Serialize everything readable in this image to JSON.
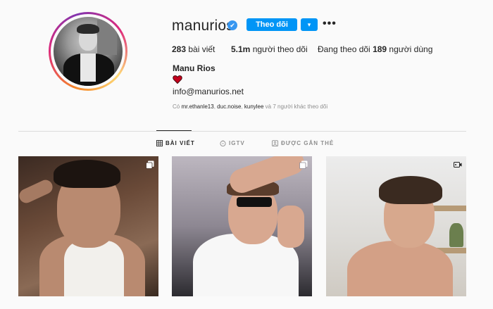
{
  "profile": {
    "username": "manurios",
    "verified_mark": "✔",
    "follow_label": "Theo dõi",
    "dropdown_glyph": "▾",
    "more_glyph": "•••",
    "full_name": "Manu Rios",
    "bio_emoji": "heart-emoji",
    "email": "info@manurios.net"
  },
  "stats": {
    "posts_count": "283",
    "posts_label": " bài viết",
    "followers_count": "5.1m",
    "followers_label": " người theo dõi",
    "following_prefix": "Đang theo dõi ",
    "following_count": "189",
    "following_label": " người dùng"
  },
  "followed_by": {
    "prefix": "Có ",
    "names": [
      "mr.ethanle13",
      "duc.noise",
      "kunylee"
    ],
    "sep1": ", ",
    "sep2": ", ",
    "suffix": " và 7 người khác theo dõi"
  },
  "tabs": [
    {
      "label": "BÀI VIẾT",
      "icon": "grid-icon",
      "active": true
    },
    {
      "label": "IGTV",
      "icon": "igtv-icon",
      "active": false
    },
    {
      "label": "ĐƯỢC GẮN THẺ",
      "icon": "tagged-icon",
      "active": false
    }
  ],
  "posts": [
    {
      "type_icon": "carousel-icon"
    },
    {
      "type_icon": "carousel-icon"
    },
    {
      "type_icon": "video-icon"
    }
  ],
  "colors": {
    "accent": "#0095f6",
    "verified": "#3897f0",
    "text": "#262626",
    "muted": "#8e8e8e",
    "background": "#fafafa",
    "divider": "#dbdbdb"
  }
}
